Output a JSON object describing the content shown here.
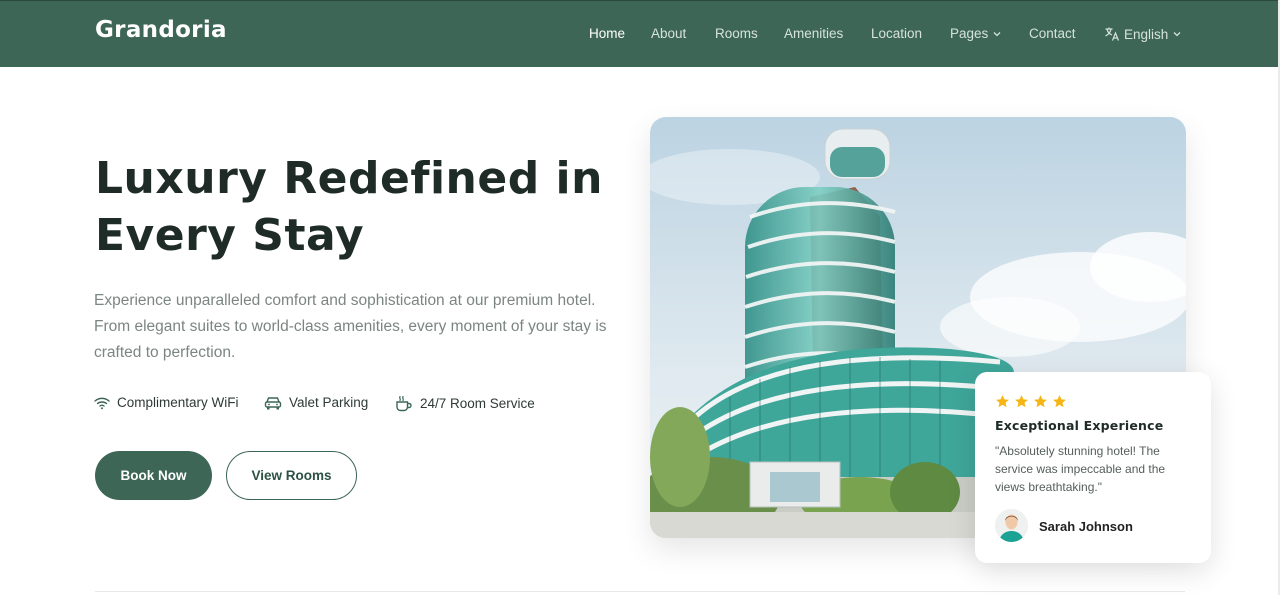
{
  "brand": {
    "name": "Grandoria"
  },
  "nav": {
    "items": [
      {
        "label": "Home",
        "active": true
      },
      {
        "label": "About"
      },
      {
        "label": "Rooms"
      },
      {
        "label": "Amenities"
      },
      {
        "label": "Location"
      },
      {
        "label": "Pages",
        "dropdown": true
      },
      {
        "label": "Contact"
      }
    ],
    "language": {
      "label": "English",
      "icon": "translate-icon"
    }
  },
  "hero": {
    "title_line1": "Luxury Redefined in",
    "title_line2": "Every Stay",
    "description": "Experience unparalleled comfort and sophistication at our premium hotel. From elegant suites to world-class amenities, every moment of your stay is crafted to perfection.",
    "features": [
      {
        "label": "Complimentary WiFi",
        "icon": "wifi-icon"
      },
      {
        "label": "Valet Parking",
        "icon": "car-icon"
      },
      {
        "label": "24/7 Room Service",
        "icon": "cup-icon"
      }
    ],
    "primary_button": "Book Now",
    "secondary_button": "View Rooms"
  },
  "review": {
    "rating": 4,
    "title": "Exceptional Experience",
    "text": "\"Absolutely stunning hotel! The service was impeccable and the views breathtaking.\"",
    "author": "Sarah Johnson"
  },
  "colors": {
    "brand_green": "#3d6657",
    "star_yellow": "#f5b514",
    "heading": "#1e2b26",
    "body_text": "#7b8581"
  }
}
